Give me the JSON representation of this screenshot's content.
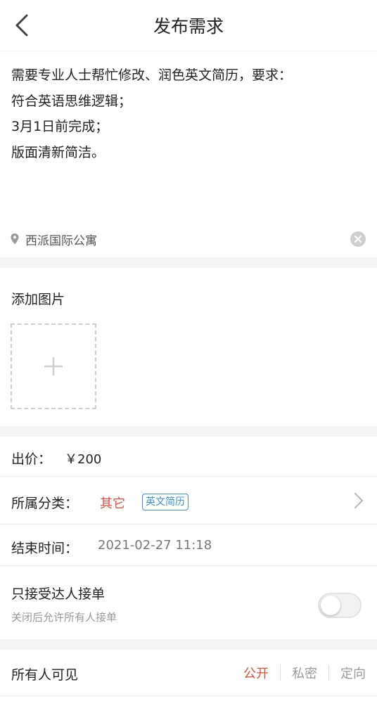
{
  "header": {
    "title": "发布需求",
    "back_icon": "chevron-left-icon"
  },
  "description": {
    "lines": [
      "需要专业人士帮忙修改、润色英文简历，要求：",
      "符合英语思维逻辑；",
      "3月1日前完成；",
      "版面清新简洁。"
    ],
    "location": "西派国际公寓",
    "location_icon": "location-pin-icon",
    "clear_icon": "clear-circle-icon"
  },
  "images": {
    "label": "添加图片",
    "add_icon": "plus-icon"
  },
  "price": {
    "label": "出价：",
    "value": "￥200"
  },
  "category": {
    "label": "所属分类：",
    "value": "其它",
    "tag": "英文简历"
  },
  "end_time": {
    "label": "结束时间：",
    "value": "2021-02-27 11:18"
  },
  "expert_only": {
    "label": "只接受达人接单",
    "hint": "关闭后允许所有人接单",
    "enabled": false
  },
  "visibility": {
    "label": "所有人可见",
    "options": [
      "公开",
      "私密",
      "定向"
    ],
    "selected": "公开"
  },
  "colors": {
    "accent": "#e74c3c",
    "tag_blue": "#3d8fd6",
    "muted": "#999999",
    "background_gap": "#f4f4f4"
  }
}
